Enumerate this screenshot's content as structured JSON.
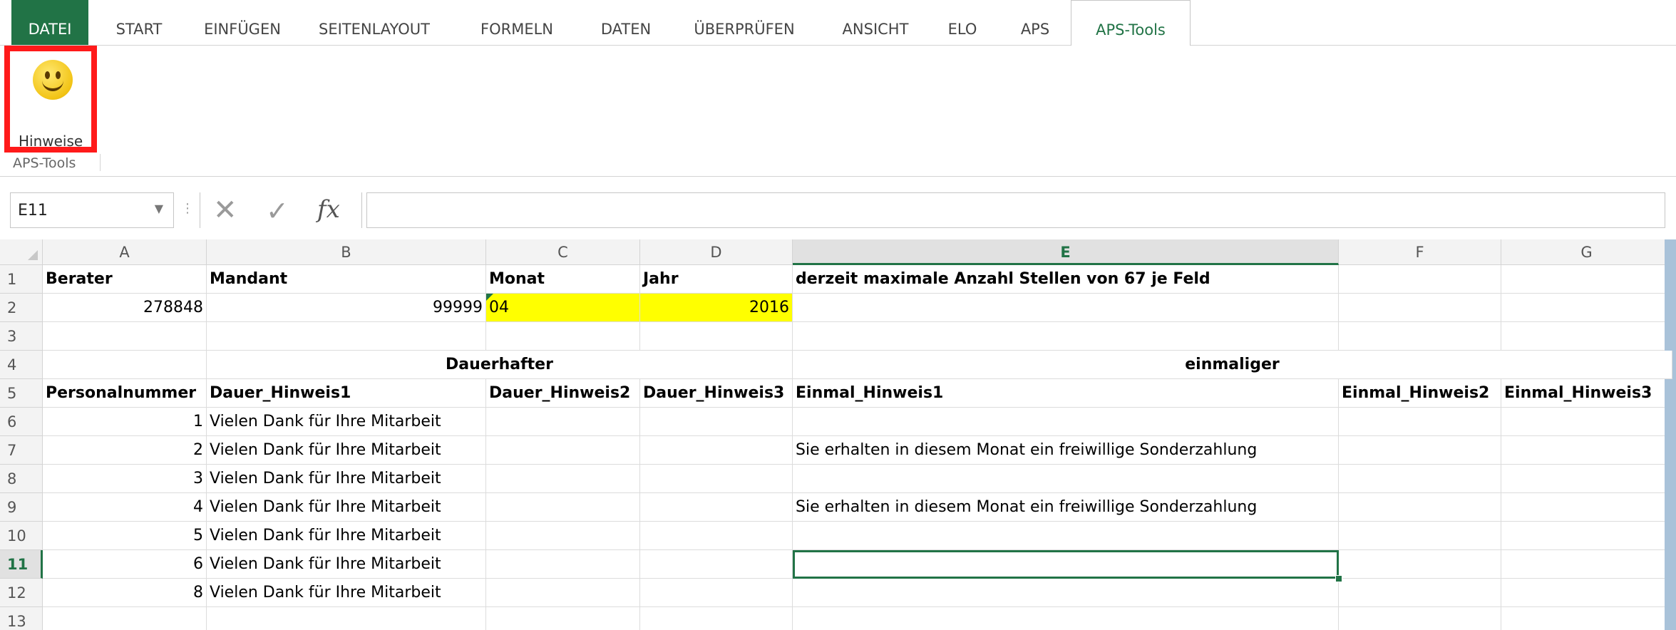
{
  "ribbon_tabs": [
    {
      "label": "DATEI",
      "kind": "file"
    },
    {
      "label": "START"
    },
    {
      "label": "EINFÜGEN"
    },
    {
      "label": "SEITENLAYOUT"
    },
    {
      "label": "FORMELN"
    },
    {
      "label": "DATEN"
    },
    {
      "label": "ÜBERPRÜFEN"
    },
    {
      "label": "ANSICHT"
    },
    {
      "label": "ELO"
    },
    {
      "label": "APS"
    },
    {
      "label": "APS-Tools",
      "active": true
    }
  ],
  "ribbon": {
    "button_label": "Hinweise",
    "button_icon": "smiley-icon",
    "group_label": "APS-Tools",
    "highlight_color": "#ff1a1a"
  },
  "formula_bar": {
    "name_box": "E11",
    "formula": "",
    "icons": [
      "cancel-icon",
      "enter-icon",
      "fx-icon"
    ]
  },
  "grid": {
    "columns": [
      "A",
      "B",
      "C",
      "D",
      "E",
      "F",
      "G"
    ],
    "selected_column": "E",
    "selected_row": "11",
    "selected_cell": "E11",
    "rows": [
      {
        "n": "1",
        "cells": [
          "Berater",
          "Mandant",
          "Monat",
          "Jahr",
          "derzeit maximale Anzahl Stellen von 67 je Feld",
          "",
          ""
        ]
      },
      {
        "n": "2",
        "cells": [
          "278848",
          "99999",
          "04",
          "2016",
          "",
          "",
          ""
        ]
      },
      {
        "n": "3",
        "cells": [
          "",
          "",
          "",
          "",
          "",
          "",
          ""
        ]
      },
      {
        "n": "4",
        "cells": [
          "",
          "Dauerhafter",
          "",
          "",
          "einmaliger",
          "",
          ""
        ]
      },
      {
        "n": "5",
        "cells": [
          "Personalnummer",
          "Dauer_Hinweis1",
          "Dauer_Hinweis2",
          "Dauer_Hinweis3",
          "Einmal_Hinweis1",
          "Einmal_Hinweis2",
          "Einmal_Hinweis3"
        ]
      },
      {
        "n": "6",
        "cells": [
          "1",
          "Vielen Dank für Ihre Mitarbeit",
          "",
          "",
          "",
          "",
          ""
        ]
      },
      {
        "n": "7",
        "cells": [
          "2",
          "Vielen Dank für Ihre Mitarbeit",
          "",
          "",
          "Sie erhalten in diesem Monat ein freiwillige Sonderzahlung",
          "",
          ""
        ]
      },
      {
        "n": "8",
        "cells": [
          "3",
          "Vielen Dank für Ihre Mitarbeit",
          "",
          "",
          "",
          "",
          ""
        ]
      },
      {
        "n": "9",
        "cells": [
          "4",
          "Vielen Dank für Ihre Mitarbeit",
          "",
          "",
          "Sie erhalten in diesem Monat ein freiwillige Sonderzahlung",
          "",
          ""
        ]
      },
      {
        "n": "10",
        "cells": [
          "5",
          "Vielen Dank für Ihre Mitarbeit",
          "",
          "",
          "",
          "",
          ""
        ]
      },
      {
        "n": "11",
        "cells": [
          "6",
          "Vielen Dank für Ihre Mitarbeit",
          "",
          "",
          "",
          "",
          ""
        ]
      },
      {
        "n": "12",
        "cells": [
          "8",
          "Vielen Dank für Ihre Mitarbeit",
          "",
          "",
          "",
          "",
          ""
        ]
      },
      {
        "n": "13",
        "cells": [
          "",
          "",
          "",
          "",
          "",
          "",
          ""
        ]
      }
    ],
    "accent_color": "#217346",
    "highlight_fill": "#ffff00"
  }
}
